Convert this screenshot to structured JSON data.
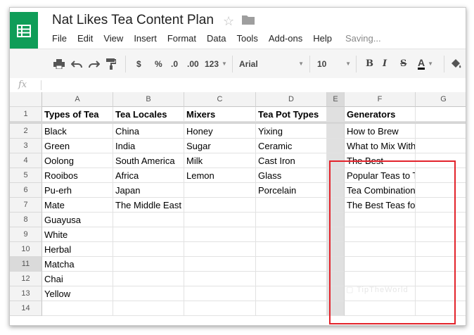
{
  "app": {
    "title": "Nat Likes Tea Content Plan",
    "status": "Saving...",
    "accent_color": "#0f9d58",
    "highlight_color": "#e3232b"
  },
  "menu": [
    "File",
    "Edit",
    "View",
    "Insert",
    "Format",
    "Data",
    "Tools",
    "Add-ons",
    "Help"
  ],
  "toolbar": {
    "currency": "$",
    "percent": "%",
    "decrease_decimal": ".0",
    "increase_decimal": ".00",
    "number_format": "123",
    "font": "Arial",
    "font_size": "10",
    "bold": "B",
    "italic": "I",
    "strikethrough": "S",
    "text_color": "A",
    "icons": [
      "print-icon",
      "undo-icon",
      "redo-icon",
      "paint-format-icon",
      "fill-color-icon"
    ]
  },
  "formula_bar": {
    "label": "fx",
    "value": ""
  },
  "columns": [
    "A",
    "B",
    "C",
    "D",
    "E",
    "F",
    "G"
  ],
  "rows": [
    {
      "num": "1",
      "cells": [
        "Types of Tea",
        "Tea Locales",
        "Mixers",
        "Tea Pot Types",
        "",
        "Generators",
        ""
      ]
    },
    {
      "num": "2",
      "cells": [
        "Black",
        "China",
        "Honey",
        "Yixing",
        "",
        "How to Brew",
        ""
      ]
    },
    {
      "num": "3",
      "cells": [
        "Green",
        "India",
        "Sugar",
        "Ceramic",
        "",
        "What to Mix With",
        ""
      ]
    },
    {
      "num": "4",
      "cells": [
        "Oolong",
        "South America",
        "Milk",
        "Cast Iron",
        "",
        "The Best",
        ""
      ]
    },
    {
      "num": "5",
      "cells": [
        "Rooibos",
        "Africa",
        "Lemon",
        "Glass",
        "",
        "Popular Teas to Try From",
        ""
      ]
    },
    {
      "num": "6",
      "cells": [
        "Pu-erh",
        "Japan",
        "",
        "Porcelain",
        "",
        "Tea Combinations",
        ""
      ]
    },
    {
      "num": "7",
      "cells": [
        "Mate",
        "The Middle East",
        "",
        "",
        "",
        "The Best Teas for a",
        ""
      ]
    },
    {
      "num": "8",
      "cells": [
        "Guayusa",
        "",
        "",
        "",
        "",
        "",
        ""
      ]
    },
    {
      "num": "9",
      "cells": [
        "White",
        "",
        "",
        "",
        "",
        "",
        ""
      ]
    },
    {
      "num": "10",
      "cells": [
        "Herbal",
        "",
        "",
        "",
        "",
        "",
        ""
      ]
    },
    {
      "num": "11",
      "cells": [
        "Matcha",
        "",
        "",
        "",
        "",
        "",
        ""
      ]
    },
    {
      "num": "12",
      "cells": [
        "Chai",
        "",
        "",
        "",
        "",
        "",
        ""
      ]
    },
    {
      "num": "13",
      "cells": [
        "Yellow",
        "",
        "",
        "",
        "",
        "",
        ""
      ]
    },
    {
      "num": "14",
      "cells": [
        "",
        "",
        "",
        "",
        "",
        "",
        ""
      ]
    }
  ],
  "selected_row": "11"
}
